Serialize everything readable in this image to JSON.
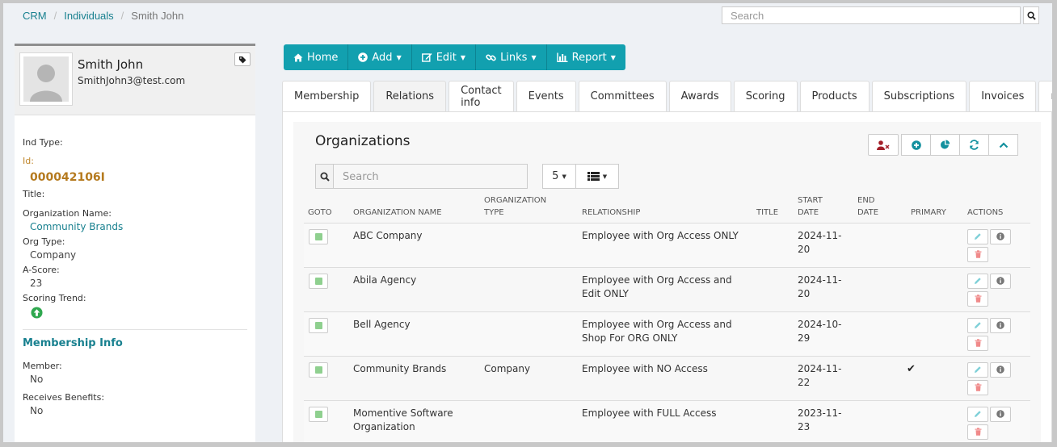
{
  "breadcrumb": {
    "items": [
      "CRM",
      "Individuals",
      "Smith John"
    ]
  },
  "top_search": {
    "placeholder": "Search"
  },
  "profile": {
    "name": "Smith John",
    "email": "SmithJohn3@test.com",
    "fields": {
      "ind_type_label": "Ind Type:",
      "id_label": "Id:",
      "id_value": "000042106I",
      "title_label": "Title:",
      "org_name_label": "Organization Name:",
      "org_name_value": "Community Brands",
      "org_type_label": "Org Type:",
      "org_type_value": "Company",
      "ascore_label": "A-Score:",
      "ascore_value": "23",
      "scoring_trend_label": "Scoring Trend:"
    },
    "membership": {
      "title": "Membership Info",
      "member_label": "Member:",
      "member_value": "No",
      "receives_label": "Receives Benefits:",
      "receives_value": "No"
    }
  },
  "toolbar": {
    "home": "Home",
    "add": "Add",
    "edit": "Edit",
    "links": "Links",
    "report": "Report"
  },
  "tabs": [
    "Membership",
    "Relations",
    "Contact info",
    "Events",
    "Committees",
    "Awards",
    "Scoring",
    "Products",
    "Subscriptions",
    "Invoices",
    "more"
  ],
  "card": {
    "title": "Organizations",
    "search_placeholder": "Search",
    "page_size": "5"
  },
  "table": {
    "headers": {
      "goto": "GOTO",
      "org_name": "ORGANIZATION NAME",
      "org_type_1": "ORGANIZATION",
      "org_type_2": "TYPE",
      "relationship": "RELATIONSHIP",
      "title": "TITLE",
      "start_1": "START",
      "start_2": "DATE",
      "end_1": "END",
      "end_2": "DATE",
      "primary": "PRIMARY",
      "actions": "ACTIONS"
    },
    "rows": [
      {
        "name": "ABC Company",
        "type": "",
        "relationship": "Employee with Org Access ONLY",
        "title": "",
        "start": "2024-11-20",
        "end": "",
        "primary": ""
      },
      {
        "name": "Abila Agency",
        "type": "",
        "relationship": "Employee with Org Access and Edit ONLY",
        "title": "",
        "start": "2024-11-20",
        "end": "",
        "primary": ""
      },
      {
        "name": "Bell Agency",
        "type": "",
        "relationship": "Employee with Org Access and Shop For ORG ONLY",
        "title": "",
        "start": "2024-10-29",
        "end": "",
        "primary": ""
      },
      {
        "name": "Community Brands",
        "type": "Company",
        "relationship": "Employee with NO Access",
        "title": "",
        "start": "2024-11-22",
        "end": "",
        "primary": "✔"
      },
      {
        "name": "Momentive Software Organization",
        "type": "",
        "relationship": "Employee with FULL Access",
        "title": "",
        "start": "2023-11-23",
        "end": "",
        "primary": ""
      }
    ]
  },
  "colors": {
    "accent": "#12a0af",
    "link": "#18808f",
    "id": "#b57a1e",
    "trend": "#2fa84f"
  }
}
